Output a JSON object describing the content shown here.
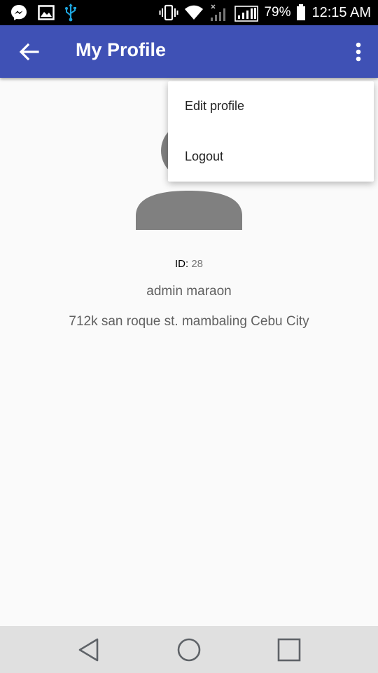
{
  "status_bar": {
    "icons": [
      "messenger-icon",
      "gallery-icon",
      "usb-icon",
      "vibrate-icon",
      "wifi-icon",
      "signal-no-service-icon",
      "signal-icon"
    ],
    "battery_percent": "79%",
    "time": "12:15 AM"
  },
  "app_bar": {
    "title": "My Profile",
    "color": "#3f51b5"
  },
  "profile": {
    "id_label": "ID:",
    "id_value": "28",
    "name": "admin maraon",
    "address": "712k san roque st. mambaling Cebu City"
  },
  "menu": {
    "items": [
      {
        "label": "Edit profile"
      },
      {
        "label": "Logout"
      }
    ]
  },
  "nav_bar": {
    "icons": [
      "back-triangle-icon",
      "home-circle-icon",
      "recents-square-icon"
    ]
  }
}
